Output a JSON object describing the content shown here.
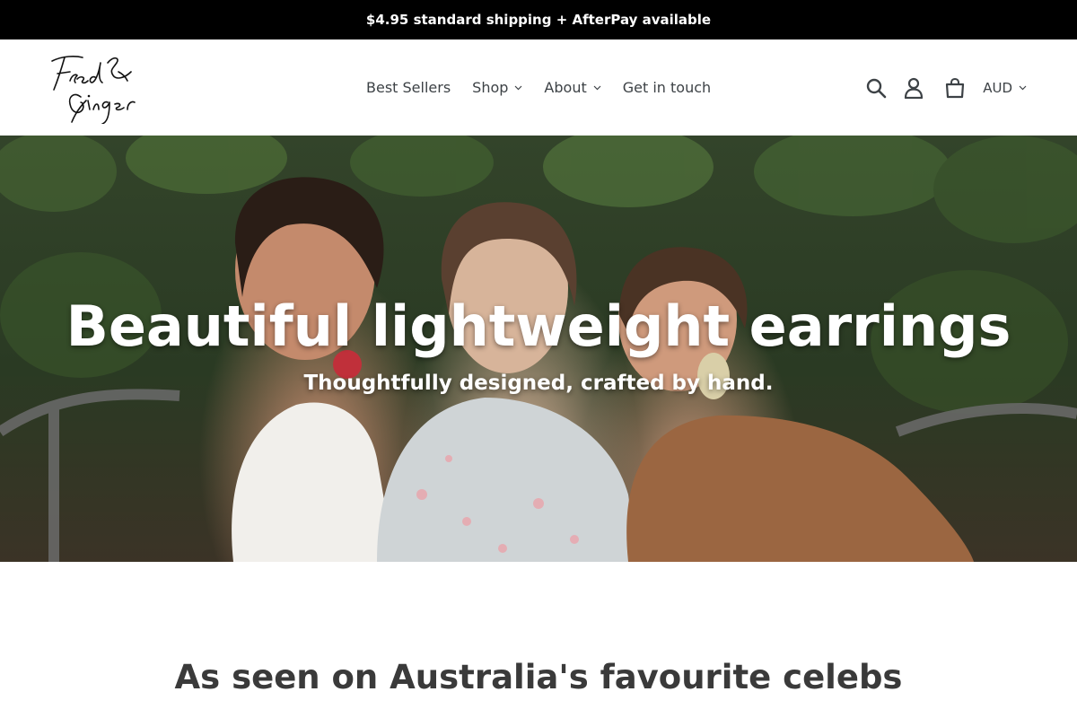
{
  "announcement": "$4.95 standard shipping + AfterPay available",
  "brand": {
    "name": "Fred & Ginger"
  },
  "nav": {
    "items": [
      {
        "label": "Best Sellers"
      },
      {
        "label": "Shop"
      },
      {
        "label": "About"
      },
      {
        "label": "Get in touch"
      }
    ]
  },
  "header_icons": [
    "search-icon",
    "account-icon",
    "cart-icon"
  ],
  "currency": {
    "selected": "AUD"
  },
  "hero": {
    "title": "Beautiful lightweight earrings",
    "subtitle": "Thoughtfully designed, crafted by hand."
  },
  "section": {
    "title": "As seen on Australia's favourite celebs"
  },
  "colors": {
    "announcement_bg": "#000000",
    "text": "#3d4246",
    "hero_text": "#ffffff"
  }
}
